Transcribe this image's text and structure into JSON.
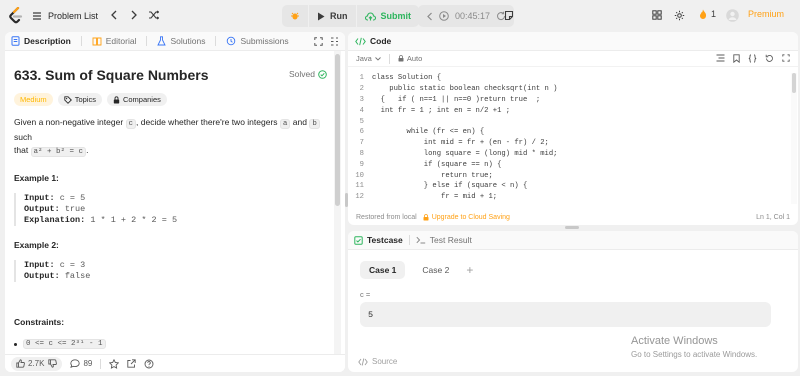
{
  "topbar": {
    "problem_list": "Problem List",
    "run": "Run",
    "submit": "Submit",
    "timer": "00:45:17",
    "streak": "1",
    "premium": "Premium",
    "colors": {
      "brand_orange": "#ffa116",
      "submit_green": "#2db55d"
    }
  },
  "left_tabs": [
    "Description",
    "Editorial",
    "Solutions",
    "Submissions"
  ],
  "problem": {
    "title": "633. Sum of Square Numbers",
    "status": "Solved",
    "tags": [
      "Medium",
      "Topics",
      "Companies"
    ],
    "desc_pre": "Given a non-negative integer ",
    "desc_c": "c",
    "desc_mid": ", decide whether there're two integers ",
    "desc_a": "a",
    "desc_and": " and ",
    "desc_b": "b",
    "desc_post": " such",
    "desc_line2_pre": "that ",
    "desc_eq": "a² + b² = c",
    "desc_line2_post": ".",
    "example1_head": "Example 1:",
    "example1": {
      "input_label": "Input:",
      "input_value": "c = 5",
      "output_label": "Output:",
      "output_value": "true",
      "expl_label": "Explanation:",
      "expl_value": "1 * 1 + 2 * 2 = 5"
    },
    "example2_head": "Example 2:",
    "example2": {
      "input_label": "Input:",
      "input_value": "c = 3",
      "output_label": "Output:",
      "output_value": "false"
    },
    "constraints_head": "Constraints:",
    "constraint1": "0 <= c <= 2³¹ - 1"
  },
  "bottom_bar": {
    "likes": "2.7K",
    "comments": "89"
  },
  "code": {
    "title": "Code",
    "language": "Java",
    "autosave": "Auto",
    "lines": [
      {
        "n": "1",
        "t": "class Solution {"
      },
      {
        "n": "2",
        "t": "    public static boolean checksqrt(int n )"
      },
      {
        "n": "3",
        "t": "  {   if ( n==1 || n==0 )return true  ;"
      },
      {
        "n": "4",
        "t": "  int fr = 1 ; int en = n/2 +1 ;"
      },
      {
        "n": "5",
        "t": ""
      },
      {
        "n": "6",
        "t": "        while (fr <= en) {"
      },
      {
        "n": "7",
        "t": "            int mid = fr + (en - fr) / 2;"
      },
      {
        "n": "8",
        "t": "            long square = (long) mid * mid;"
      },
      {
        "n": "9",
        "t": "            if (square == n) {"
      },
      {
        "n": "10",
        "t": "                return true;"
      },
      {
        "n": "11",
        "t": "            } else if (square < n) {"
      },
      {
        "n": "12",
        "t": "                fr = mid + 1;"
      }
    ],
    "footer_restored": "Restored from local",
    "footer_upgrade": "Upgrade to Cloud Saving",
    "footer_position": "Ln 1, Col 1"
  },
  "testcase": {
    "tab_testcase": "Testcase",
    "tab_result": "Test Result",
    "cases": [
      "Case 1",
      "Case 2"
    ],
    "var_label": "c =",
    "var_value": "5",
    "source": "Source"
  },
  "watermark": {
    "line1": "Activate Windows",
    "line2": "Go to Settings to activate Windows."
  }
}
